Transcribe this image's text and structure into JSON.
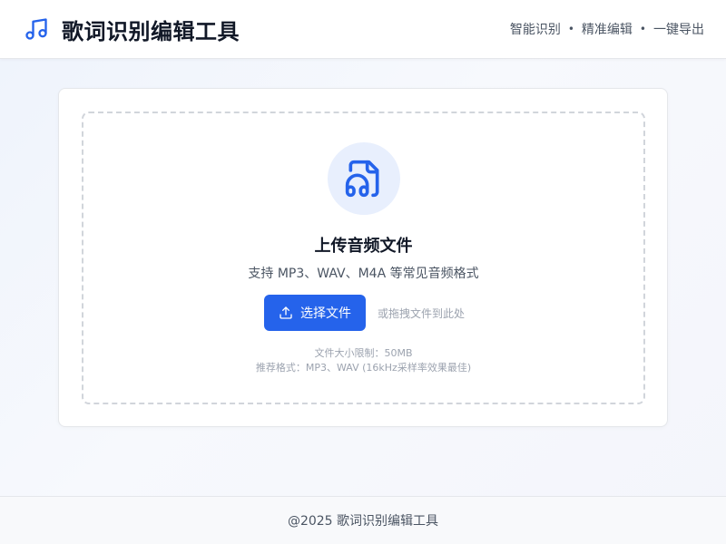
{
  "header": {
    "logo_icon": "music-note-icon",
    "title": "歌词识别编辑工具",
    "features": [
      "智能识别",
      "精准编辑",
      "一键导出"
    ],
    "separator": "•"
  },
  "upload": {
    "icon": "audio-file-icon",
    "title": "上传音频文件",
    "subtitle": "支持 MP3、WAV、M4A 等常见音频格式",
    "button_icon": "upload-icon",
    "button_label": "选择文件",
    "drag_hint": "或拖拽文件到此处",
    "size_limit": "文件大小限制：50MB",
    "recommended": "推荐格式：MP3、WAV (16kHz采样率效果最佳)"
  },
  "footer": {
    "text": "@2025 歌词识别编辑工具"
  },
  "colors": {
    "accent": "#2563eb",
    "icon_bg": "#e8effd",
    "border": "#d1d5db"
  }
}
